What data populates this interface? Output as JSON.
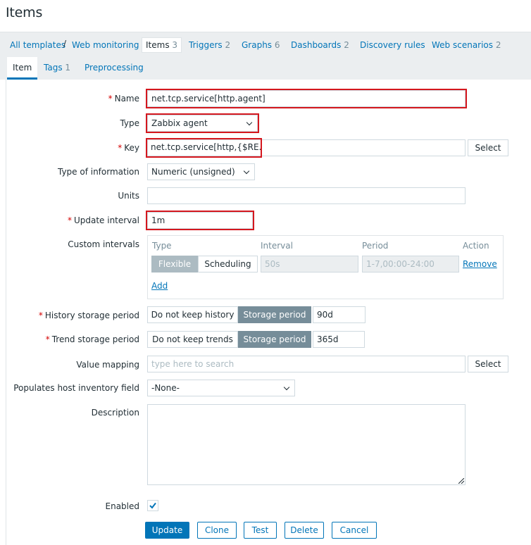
{
  "page": {
    "title": "Items"
  },
  "nav": {
    "items": [
      {
        "label": "All templates",
        "count": ""
      },
      {
        "label": "Web monitoring",
        "count": ""
      },
      {
        "label": "Items",
        "count": "3"
      },
      {
        "label": "Triggers",
        "count": "2"
      },
      {
        "label": "Graphs",
        "count": "6"
      },
      {
        "label": "Dashboards",
        "count": "2"
      },
      {
        "label": "Discovery rules",
        "count": ""
      },
      {
        "label": "Web scenarios",
        "count": "2"
      }
    ],
    "separator": "/"
  },
  "tabs": [
    {
      "label": "Item",
      "count": ""
    },
    {
      "label": "Tags",
      "count": "1"
    },
    {
      "label": "Preprocessing",
      "count": ""
    }
  ],
  "form": {
    "required_mark": "*",
    "name": {
      "label": "Name",
      "value": "net.tcp.service[http.agent]"
    },
    "type": {
      "label": "Type",
      "value": "Zabbix agent"
    },
    "key": {
      "label": "Key",
      "value": "net.tcp.service[http,{$RE.IP}]",
      "select_button": "Select"
    },
    "type_of_information": {
      "label": "Type of information",
      "value": "Numeric (unsigned)"
    },
    "units": {
      "label": "Units",
      "value": ""
    },
    "update_interval": {
      "label": "Update interval",
      "value": "1m"
    },
    "custom_intervals": {
      "label": "Custom intervals",
      "headers": {
        "type": "Type",
        "interval": "Interval",
        "period": "Period",
        "action": "Action"
      },
      "row": {
        "flexible": "Flexible",
        "scheduling": "Scheduling",
        "interval_placeholder": "50s",
        "period_placeholder": "1-7,00:00-24:00",
        "remove": "Remove"
      },
      "add": "Add"
    },
    "history": {
      "label": "History storage period",
      "option_off": "Do not keep history",
      "option_on": "Storage period",
      "value": "90d"
    },
    "trends": {
      "label": "Trend storage period",
      "option_off": "Do not keep trends",
      "option_on": "Storage period",
      "value": "365d"
    },
    "value_mapping": {
      "label": "Value mapping",
      "placeholder": "type here to search",
      "select_button": "Select"
    },
    "inventory": {
      "label": "Populates host inventory field",
      "value": "-None-"
    },
    "description": {
      "label": "Description",
      "value": ""
    },
    "enabled": {
      "label": "Enabled",
      "checked": true
    }
  },
  "buttons": {
    "update": "Update",
    "clone": "Clone",
    "test": "Test",
    "delete": "Delete",
    "cancel": "Cancel"
  },
  "colors": {
    "accent": "#0275b8",
    "highlight": "#d5171e",
    "required": "#d40000"
  }
}
